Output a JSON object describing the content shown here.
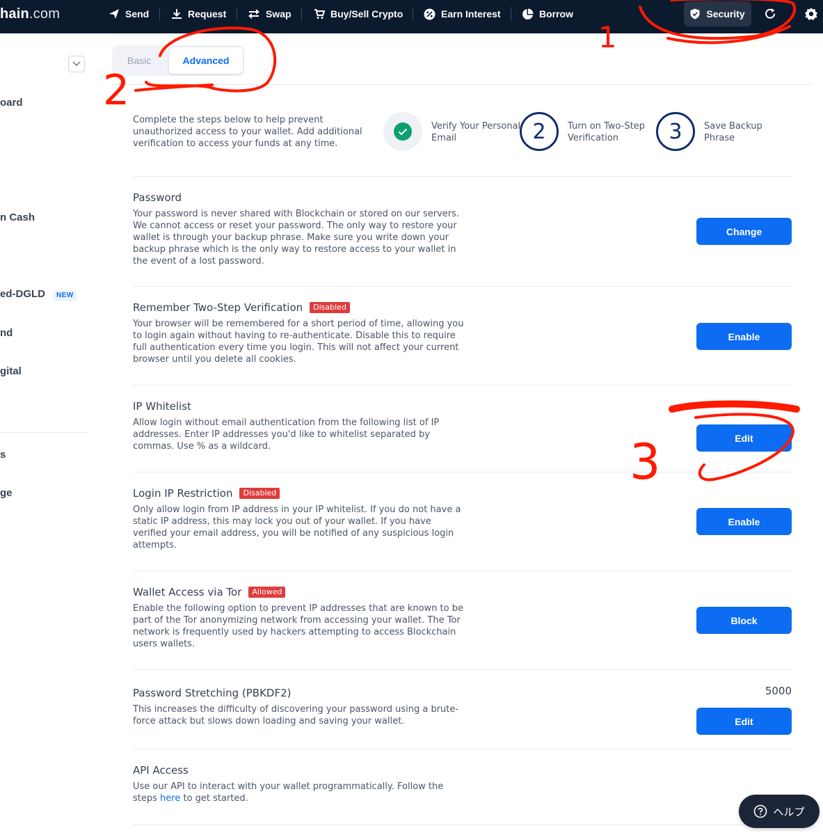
{
  "brand": {
    "text_bold": "hain",
    "text_light": ".com"
  },
  "nav": {
    "send": "Send",
    "request": "Request",
    "swap": "Swap",
    "buy_sell": "Buy/Sell Crypto",
    "earn": "Earn Interest",
    "borrow": "Borrow",
    "security": "Security"
  },
  "sidebar": {
    "items": [
      {
        "label": "oard"
      },
      {
        "label": "n Cash"
      },
      {
        "label": "ed-DGLD"
      },
      {
        "label": "nd"
      },
      {
        "label": "gital"
      },
      {
        "label": "s"
      },
      {
        "label": "ge"
      }
    ],
    "new_badge": "NEW"
  },
  "tabs": {
    "basic": "Basic",
    "advanced": "Advanced"
  },
  "intro": {
    "text": "Complete the steps below to help prevent unauthorized access to your wallet. Add additional verification to access your funds at any time.",
    "steps": [
      {
        "number": "",
        "label": "Verify Your Personal Email"
      },
      {
        "number": "2",
        "label": "Turn on Two-Step Verification"
      },
      {
        "number": "3",
        "label": "Save Backup Phrase"
      }
    ]
  },
  "rows": {
    "password": {
      "title": "Password",
      "desc": "Your password is never shared with Blockchain or stored on our servers. We cannot access or reset your password. The only way to restore your wallet is through your backup phrase. Make sure you write down your backup phrase which is the only way to restore access to your wallet in the event of a lost password.",
      "button": "Change"
    },
    "remember_2fa": {
      "title": "Remember Two-Step Verification",
      "status": "Disabled",
      "desc": "Your browser will be remembered for a short period of time, allowing you to login again without having to re-authenticate. Disable this to require full authentication every time you login. This will not affect your current browser until you delete all cookies.",
      "button": "Enable"
    },
    "ip_whitelist": {
      "title": "IP Whitelist",
      "desc": "Allow login without email authentication from the following list of IP addresses. Enter IP addresses you'd like to whitelist separated by commas. Use % as a wildcard.",
      "button": "Edit"
    },
    "login_ip": {
      "title": "Login IP Restriction",
      "status": "Disabled",
      "desc": "Only allow login from IP address in your IP whitelist. If you do not have a static IP address, this may lock you out of your wallet. If you have verified your email address, you will be notified of any suspicious login attempts.",
      "button": "Enable"
    },
    "tor": {
      "title": "Wallet Access via Tor",
      "status": "Allowed",
      "desc": "Enable the following option to prevent IP addresses that are known to be part of the Tor anonymizing network from accessing your wallet. The Tor network is frequently used by hackers attempting to access Blockchain users wallets.",
      "button": "Block"
    },
    "pbkdf2": {
      "title": "Password Stretching (PBKDF2)",
      "value": "5000",
      "desc": "This increases the difficulty of discovering your password using a brute-force attack but slows down loading and saving your wallet.",
      "button": "Edit"
    },
    "api": {
      "title": "API Access",
      "desc_before": "Use our API to interact with your wallet programmatically. Follow the steps ",
      "link": "here",
      "desc_after": " to get started."
    }
  },
  "help": {
    "label": "ヘルプ"
  },
  "annotations": {
    "marker_1": "1",
    "marker_2": "2",
    "marker_3": "3",
    "color": "#ff1a00"
  },
  "colors": {
    "nav_bg": "#0c1a2e",
    "primary": "#0c6cf2",
    "badge_red": "#de3d3d",
    "success": "#0e9f6e",
    "step_ring": "#0c2d6b"
  }
}
